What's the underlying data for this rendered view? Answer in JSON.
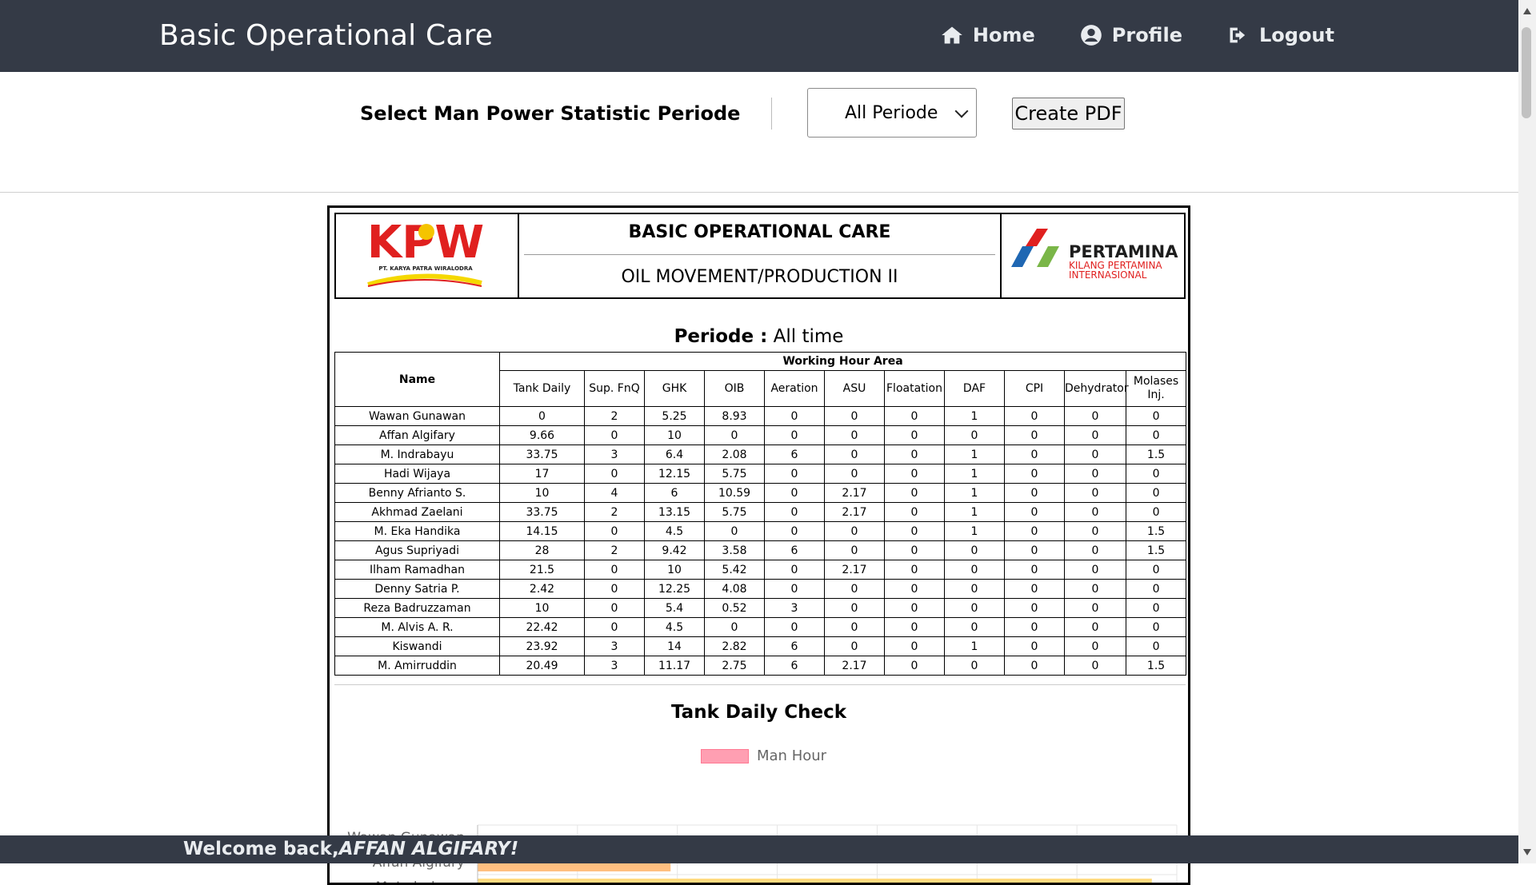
{
  "navbar": {
    "brand": "Basic Operational Care",
    "links": [
      {
        "label": "Home",
        "icon": "home-icon"
      },
      {
        "label": "Profile",
        "icon": "user-circle-icon"
      },
      {
        "label": "Logout",
        "icon": "logout-icon"
      }
    ]
  },
  "controls": {
    "label": "Select Man Power Statistic Periode",
    "selected_period": "All Periode",
    "pdf_button": "Create PDF"
  },
  "report": {
    "title": "BASIC OPERATIONAL CARE",
    "subtitle": "OIL MOVEMENT/PRODUCTION II",
    "left_logo_text": "KPW",
    "left_logo_caption": "PT. KARYA PATRA WIRALODRA",
    "right_logo_name": "PERTAMINA",
    "right_logo_caption1": "KILANG PERTAMINA",
    "right_logo_caption2": "INTERNASIONAL",
    "periode_label": "Periode :",
    "periode_value": "All time",
    "table": {
      "name_header": "Name",
      "group_header": "Working Hour Area",
      "columns": [
        "Tank Daily",
        "Sup. FnQ",
        "GHK",
        "OIB",
        "Aeration",
        "ASU",
        "Floatation",
        "DAF",
        "CPI",
        "Dehydrator",
        "Molases Inj."
      ],
      "rows": [
        [
          "Wawan Gunawan",
          "0",
          "2",
          "5.25",
          "8.93",
          "0",
          "0",
          "0",
          "1",
          "0",
          "0",
          "0"
        ],
        [
          "Affan Algifary",
          "9.66",
          "0",
          "10",
          "0",
          "0",
          "0",
          "0",
          "0",
          "0",
          "0",
          "0"
        ],
        [
          "M. Indrabayu",
          "33.75",
          "3",
          "6.4",
          "2.08",
          "6",
          "0",
          "0",
          "1",
          "0",
          "0",
          "1.5"
        ],
        [
          "Hadi Wijaya",
          "17",
          "0",
          "12.15",
          "5.75",
          "0",
          "0",
          "0",
          "1",
          "0",
          "0",
          "0"
        ],
        [
          "Benny Afrianto S.",
          "10",
          "4",
          "6",
          "10.59",
          "0",
          "2.17",
          "0",
          "1",
          "0",
          "0",
          "0"
        ],
        [
          "Akhmad Zaelani",
          "33.75",
          "2",
          "13.15",
          "5.75",
          "0",
          "2.17",
          "0",
          "1",
          "0",
          "0",
          "0"
        ],
        [
          "M. Eka Handika",
          "14.15",
          "0",
          "4.5",
          "0",
          "0",
          "0",
          "0",
          "1",
          "0",
          "0",
          "1.5"
        ],
        [
          "Agus Supriyadi",
          "28",
          "2",
          "9.42",
          "3.58",
          "6",
          "0",
          "0",
          "0",
          "0",
          "0",
          "1.5"
        ],
        [
          "Ilham Ramadhan",
          "21.5",
          "0",
          "10",
          "5.42",
          "0",
          "2.17",
          "0",
          "0",
          "0",
          "0",
          "0"
        ],
        [
          "Denny Satria P.",
          "2.42",
          "0",
          "12.25",
          "4.08",
          "0",
          "0",
          "0",
          "0",
          "0",
          "0",
          "0"
        ],
        [
          "Reza Badruzzaman",
          "10",
          "0",
          "5.4",
          "0.52",
          "3",
          "0",
          "0",
          "0",
          "0",
          "0",
          "0"
        ],
        [
          "M. Alvis A. R.",
          "22.42",
          "0",
          "4.5",
          "0",
          "0",
          "0",
          "0",
          "0",
          "0",
          "0",
          "0"
        ],
        [
          "Kiswandi",
          "23.92",
          "3",
          "14",
          "2.82",
          "6",
          "0",
          "0",
          "1",
          "0",
          "0",
          "0"
        ],
        [
          "M. Amirruddin",
          "20.49",
          "3",
          "11.17",
          "2.75",
          "6",
          "2.17",
          "0",
          "0",
          "0",
          "0",
          "1.5"
        ]
      ]
    }
  },
  "chart_data": {
    "type": "bar",
    "orientation": "horizontal",
    "title": "Tank Daily Check",
    "categories": [
      "Wawan Gunawan",
      "Affan Algifary",
      "M. Indrabayu"
    ],
    "series": [
      {
        "name": "Man Hour",
        "values": [
          0,
          9.66,
          33.75
        ]
      }
    ],
    "xlim": [
      0,
      35
    ],
    "grid": true,
    "legend": "top",
    "colors": {
      "legend": "#ff9fb2",
      "bars": [
        "#ff9fb2",
        "#ffbf80",
        "#ffdb80"
      ]
    }
  },
  "footer": {
    "prefix": "Welcome back,",
    "user": "AFFAN ALGIFARY!"
  }
}
